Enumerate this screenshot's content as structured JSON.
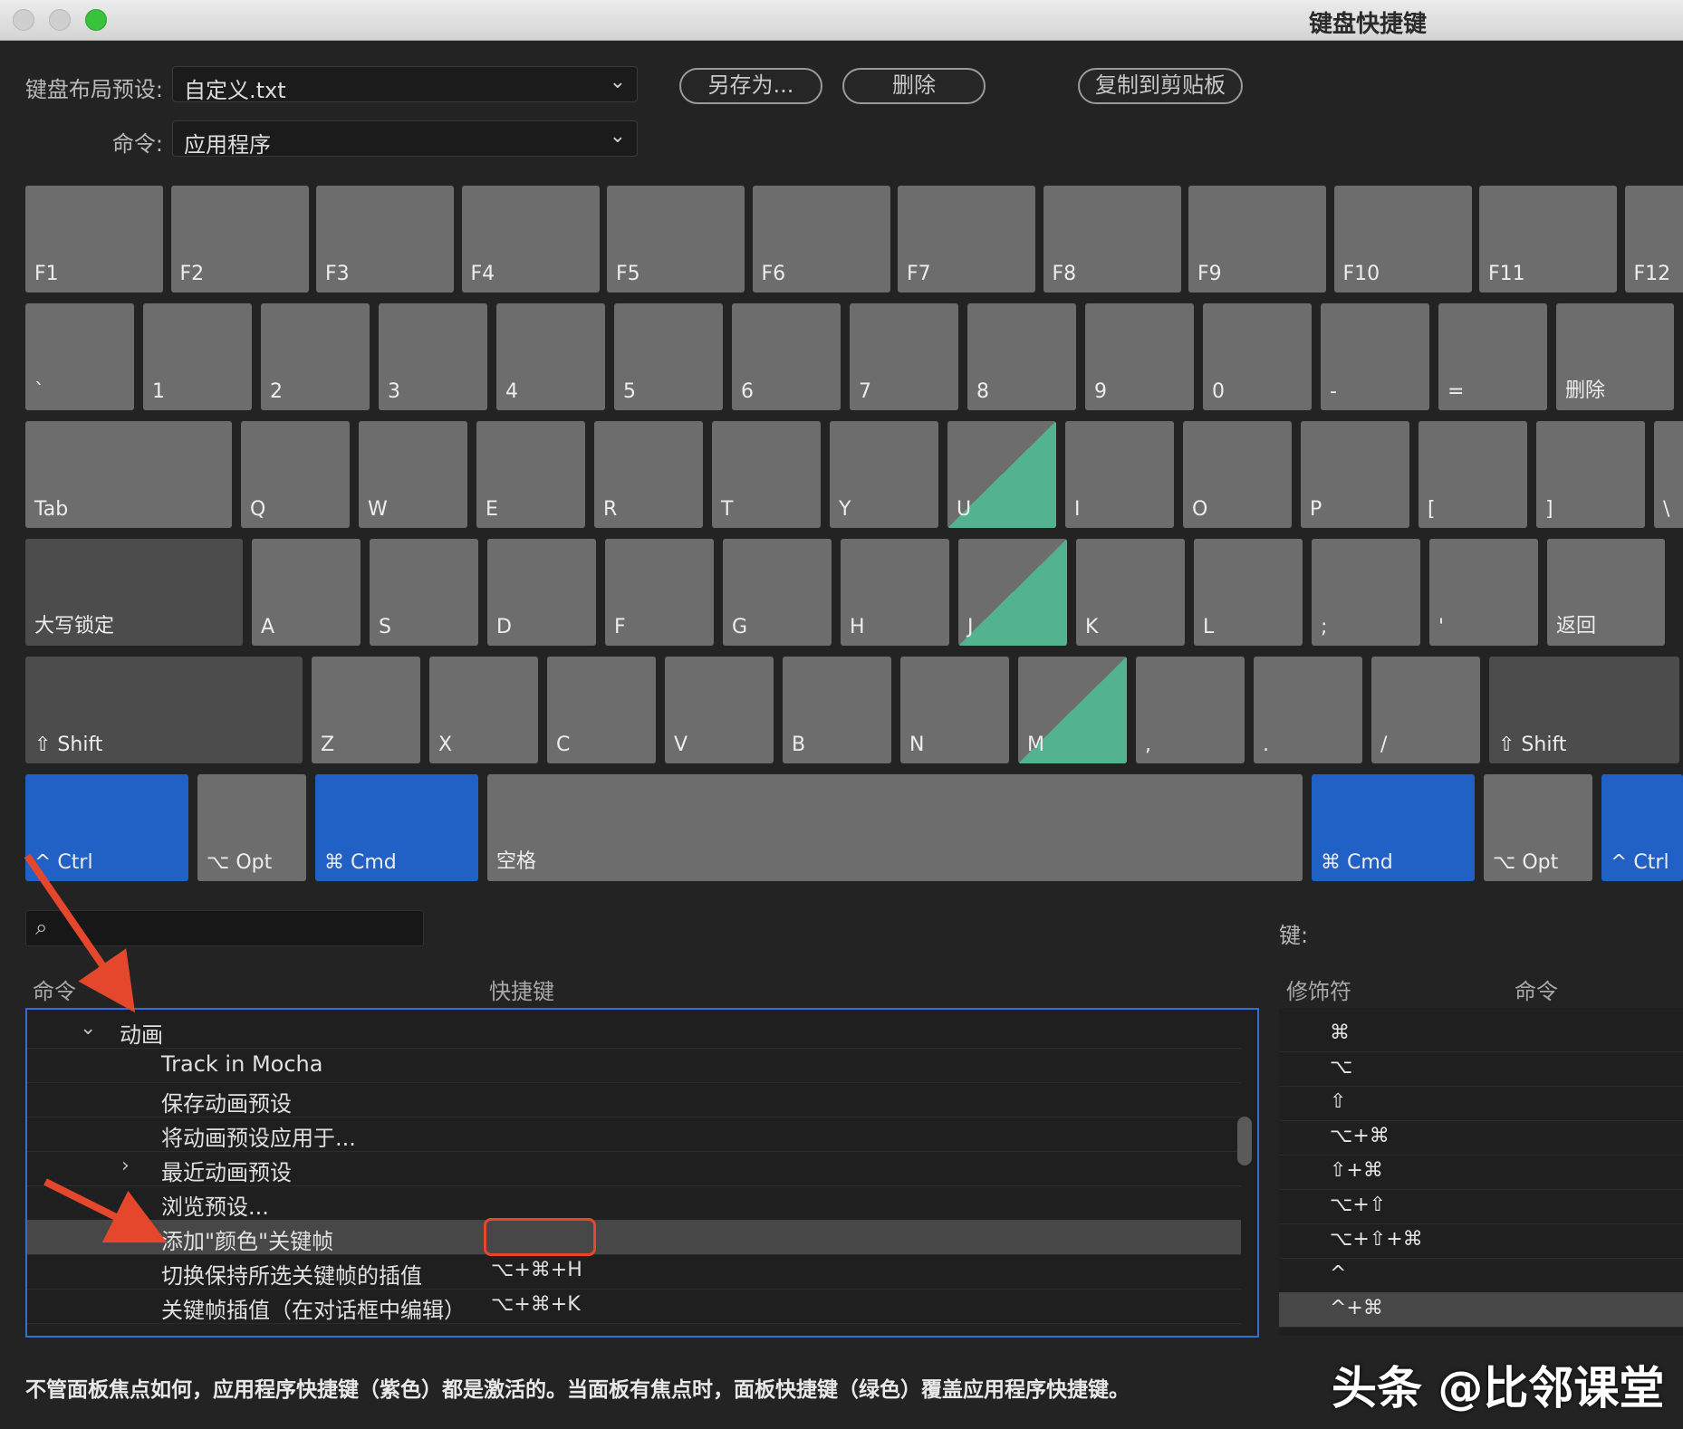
{
  "window": {
    "title": "键盘快捷键"
  },
  "preset": {
    "label": "键盘布局预设:",
    "value": "自定义.txt"
  },
  "command_set": {
    "label": "命令:",
    "value": "应用程序"
  },
  "buttons": {
    "save_as": "另存为...",
    "delete": "删除",
    "copy_clipboard": "复制到剪贴板"
  },
  "keyboard": {
    "fn_row": [
      "F1",
      "F2",
      "F3",
      "F4",
      "F5",
      "F6",
      "F7",
      "F8",
      "F9",
      "F10",
      "F11",
      "F12"
    ],
    "num_row": [
      "`",
      "1",
      "2",
      "3",
      "4",
      "5",
      "6",
      "7",
      "8",
      "9",
      "0",
      "-",
      "=",
      "删除"
    ],
    "q_row": [
      "Tab",
      "Q",
      "W",
      "E",
      "R",
      "T",
      "Y",
      "U",
      "I",
      "O",
      "P",
      "[",
      "]",
      "\\"
    ],
    "a_row": [
      "大写锁定",
      "A",
      "S",
      "D",
      "F",
      "G",
      "H",
      "J",
      "K",
      "L",
      ";",
      "'",
      "返回"
    ],
    "z_row": [
      "⇧ Shift",
      "Z",
      "X",
      "C",
      "V",
      "B",
      "N",
      "M",
      ",",
      ".",
      "/",
      "⇧ Shift"
    ],
    "bottom_row": [
      "^ Ctrl",
      "⌥ Opt",
      "⌘ Cmd",
      "空格",
      "⌘ Cmd",
      "⌥ Opt",
      "^ Ctrl"
    ],
    "highlighted_keys": [
      "U",
      "J",
      "M"
    ],
    "highlight_color": "#54b38f",
    "modifier_active_color": "#2160c4"
  },
  "search": {
    "placeholder": "",
    "icon": "search-icon"
  },
  "key_panel": {
    "label": "键:"
  },
  "table": {
    "headers": {
      "command": "命令",
      "shortcut": "快捷键"
    },
    "rows": [
      {
        "label": "动画",
        "shortcut": "",
        "expander": "⌄"
      },
      {
        "label": "Track in Mocha",
        "shortcut": ""
      },
      {
        "label": "保存动画预设",
        "shortcut": ""
      },
      {
        "label": "将动画预设应用于...",
        "shortcut": ""
      },
      {
        "label": "最近动画预设",
        "shortcut": "",
        "expander": "›"
      },
      {
        "label": "浏览预设...",
        "shortcut": ""
      },
      {
        "label": "添加\"颜色\"关键帧",
        "shortcut": "",
        "selected": true
      },
      {
        "label": "切换保持所选关键帧的插值",
        "shortcut": "⌥+⌘+H"
      },
      {
        "label": "关键帧插值（在对话框中编辑）",
        "shortcut": "⌥+⌘+K"
      }
    ]
  },
  "modifier_table": {
    "headers": {
      "modifier": "修饰符",
      "command": "命令"
    },
    "rows": [
      "⌘",
      "⌥",
      "⇧",
      "⌥+⌘",
      "⇧+⌘",
      "⌥+⇧",
      "⌥+⇧+⌘",
      "^",
      "^+⌘"
    ]
  },
  "footer": "不管面板焦点如何，应用程序快捷键（紫色）都是激活的。当面板有焦点时，面板快捷键（绿色）覆盖应用程序快捷键。",
  "watermark": "头条 @比邻课堂",
  "annotation_color": "#e5472c"
}
